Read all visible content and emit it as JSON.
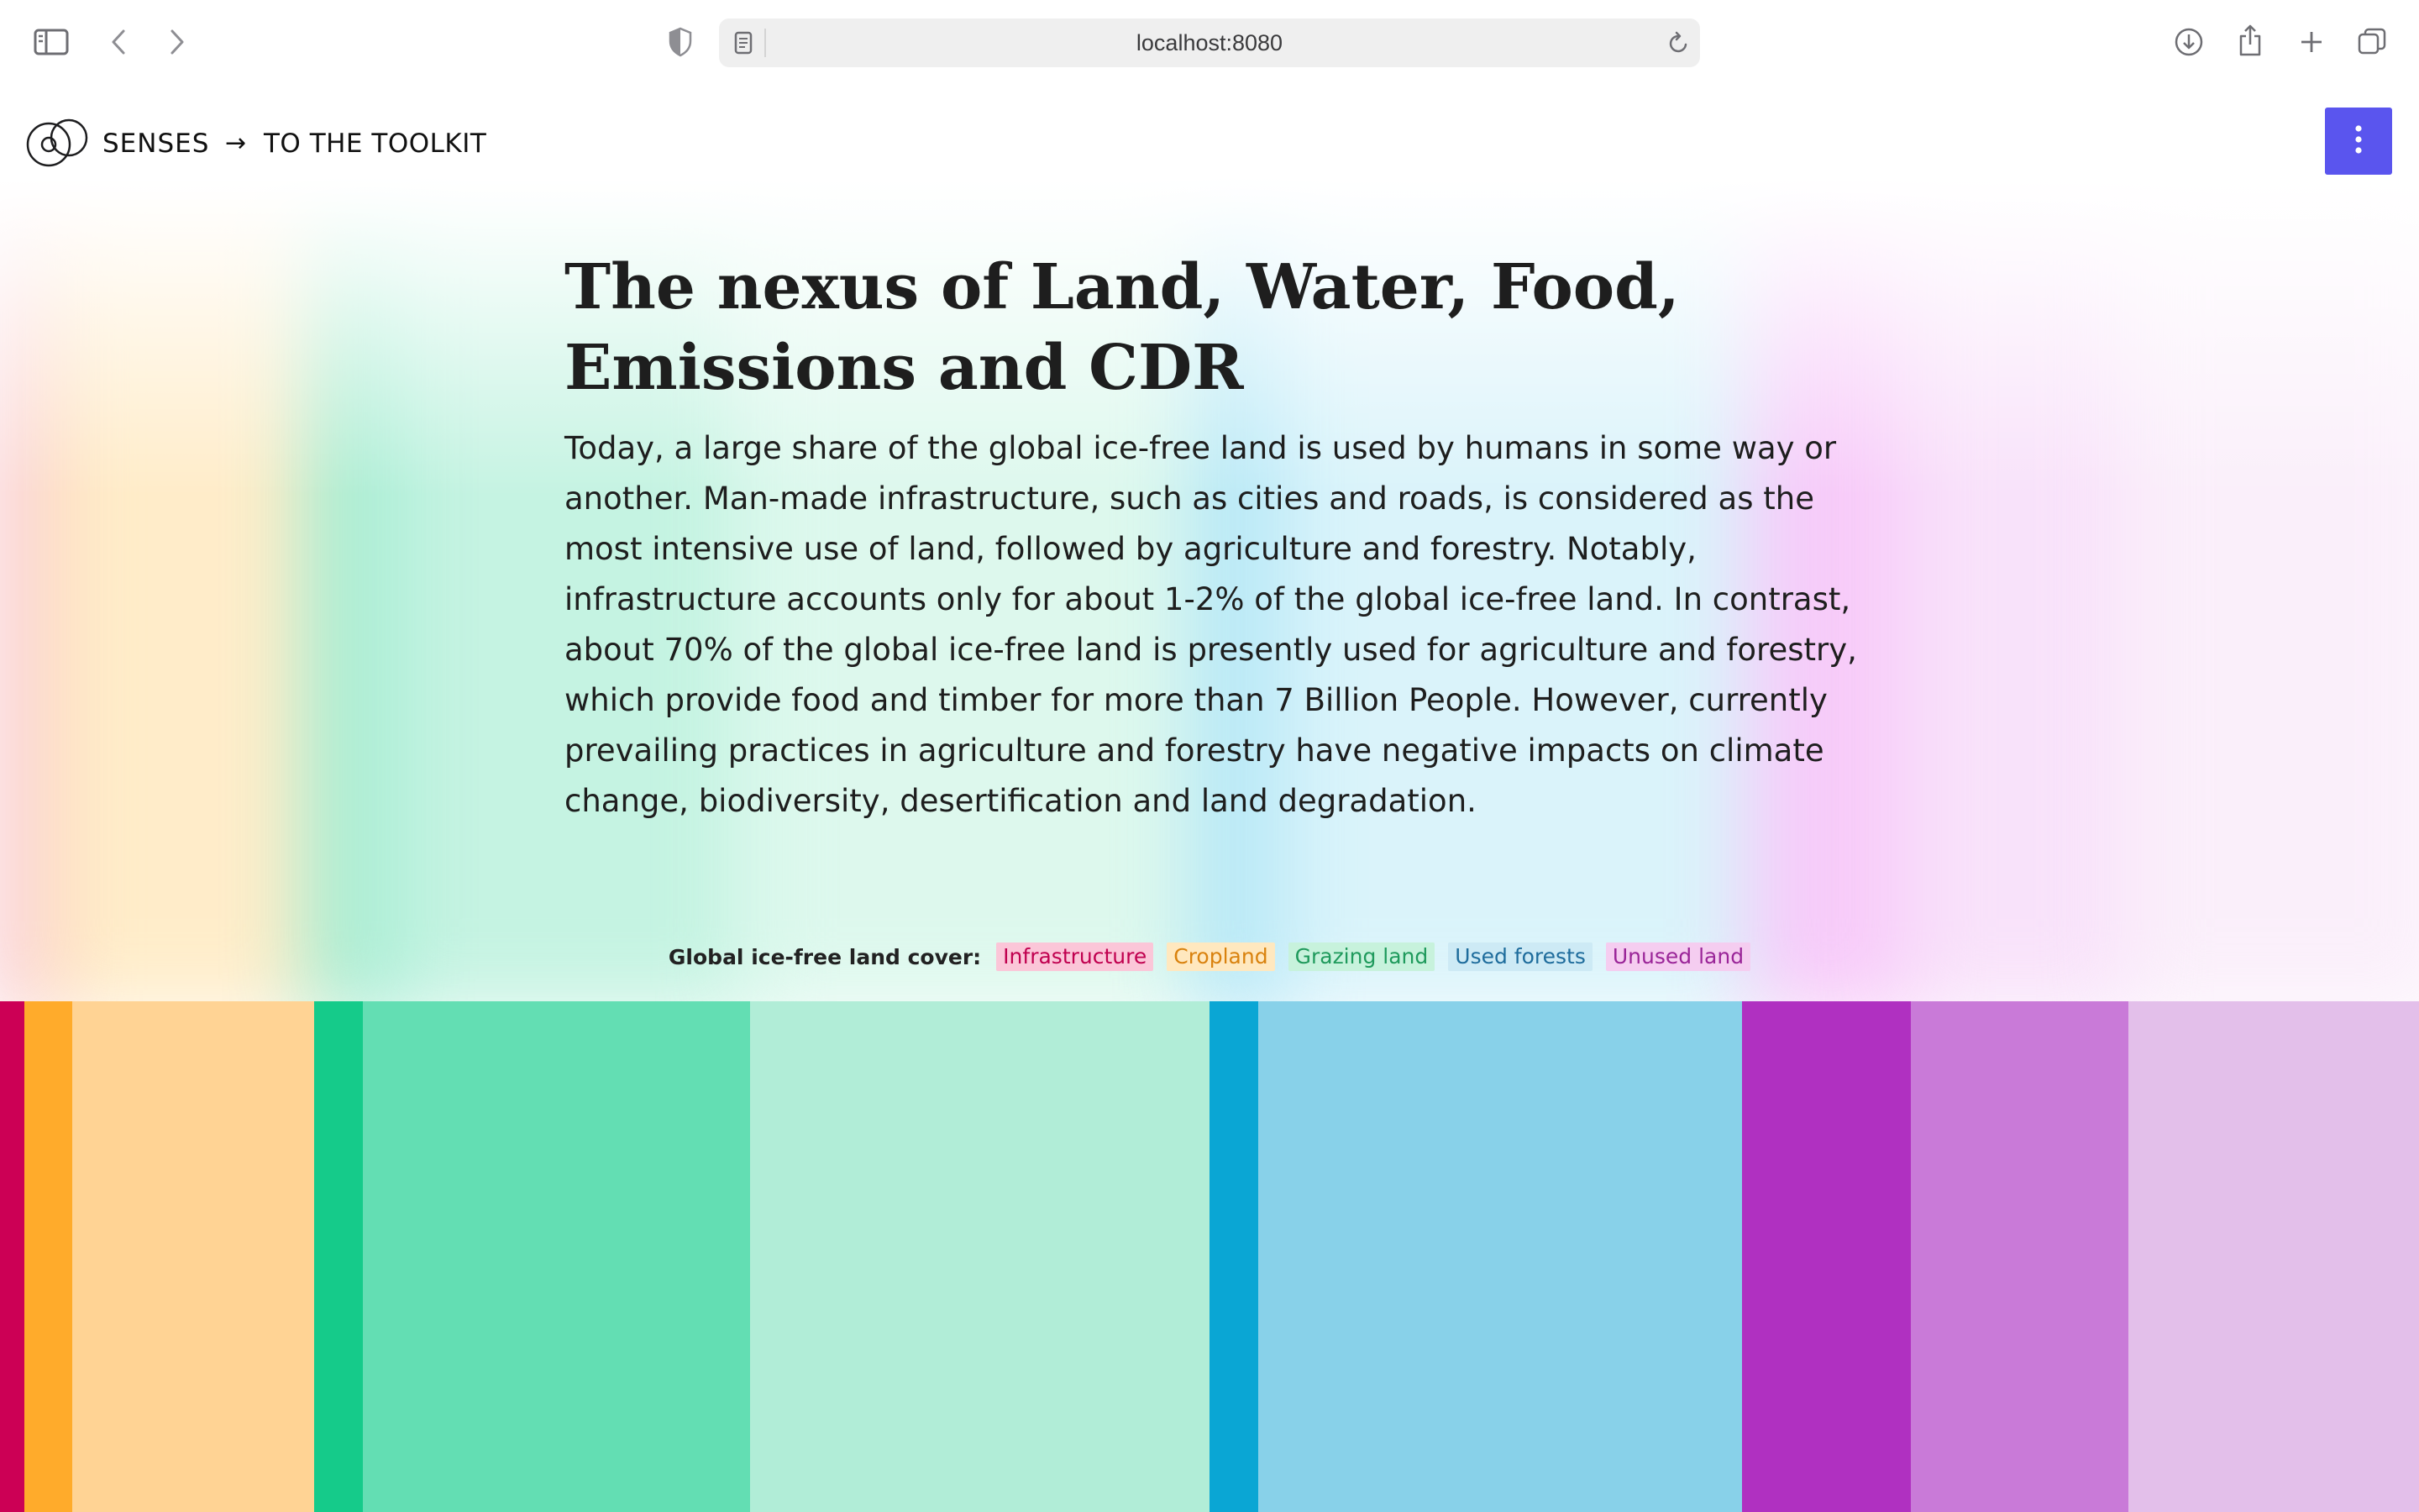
{
  "browser": {
    "url": "localhost:8080",
    "icons": [
      "sidebar-icon",
      "back-icon",
      "forward-icon",
      "shield-icon",
      "reader-icon",
      "reload-icon",
      "download-icon",
      "share-icon",
      "new-tab-icon",
      "tab-overview-icon"
    ]
  },
  "header": {
    "brand": "SENSES",
    "arrow": "→",
    "toolkit_link": "TO THE TOOLKIT",
    "menu_icon": "more-vertical-icon",
    "menu_color": "#5a55ee"
  },
  "hero": {
    "title": "The nexus of Land, Water, Food, Emissions and CDR",
    "intro": "Today, a large share of the global ice-free land is used by humans in some way or another. Man-made infrastructure, such as cities and roads, is considered as the most intensive use of land, followed by agriculture and forestry. Notably, infrastructure accounts only for about 1-2% of the global ice-free land. In contrast, about 70% of the global ice-free land is presently used for agriculture and forestry, which provide food and timber for more than 7 Billion People. However, currently prevailing practices in agriculture and forestry have negative impacts on climate change, biodiversity, desertification and land degradation."
  },
  "legend": {
    "label": "Global ice-free land cover:",
    "items": [
      {
        "label": "Infrastructure",
        "text_color": "#c0004f",
        "bg_color": "#fbc6d8"
      },
      {
        "label": "Cropland",
        "text_color": "#d9820e",
        "bg_color": "#ffe8bf"
      },
      {
        "label": "Grazing land",
        "text_color": "#1f9a5c",
        "bg_color": "#c7f2dc"
      },
      {
        "label": "Used forests",
        "text_color": "#1e6c9c",
        "bg_color": "#cdeaf5"
      },
      {
        "label": "Unused land",
        "text_color": "#9a2598",
        "bg_color": "#f5cdf0"
      }
    ]
  },
  "bars": [
    {
      "name": "infrastructure",
      "share": 1.0,
      "color": "#cc0055"
    },
    {
      "name": "cropland-intensive",
      "share": 2.0,
      "color": "#ffab2b"
    },
    {
      "name": "cropland",
      "share": 10.0,
      "color": "#ffd394"
    },
    {
      "name": "grazing-intensive",
      "share": 2.0,
      "color": "#15cb8a"
    },
    {
      "name": "grazing-medium",
      "share": 16.0,
      "color": "#63deb3"
    },
    {
      "name": "grazing-extensive",
      "share": 19.0,
      "color": "#b1edd7"
    },
    {
      "name": "forest-intensive",
      "share": 2.0,
      "color": "#0aa6d4"
    },
    {
      "name": "forest-used",
      "share": 20.0,
      "color": "#88d1e9"
    },
    {
      "name": "unused-1",
      "share": 7.0,
      "color": "#b030c1"
    },
    {
      "name": "unused-2",
      "share": 9.0,
      "color": "#c97ad8"
    },
    {
      "name": "unused-3",
      "share": 12.0,
      "color": "#e3bfea"
    }
  ]
}
